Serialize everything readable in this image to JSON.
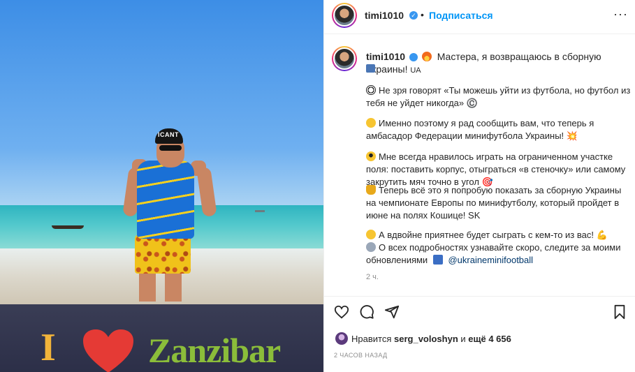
{
  "post_image": {
    "cap_text": "ICANT",
    "banner_i": "I",
    "banner_word": "Zanzibar"
  },
  "header": {
    "username": "timi1010",
    "separator": "•",
    "follow_label": "Подписаться",
    "more_label": "···"
  },
  "caption": {
    "username": "timi1010",
    "headline": "Мастера, я возвращаюсь в сборную Украины!",
    "flag": "UA",
    "lines": [
      "Не зря говорят «Ты можешь уйти из футбола, но футбол из тебя не уйдет никогда» ©️",
      "Именно поэтому я рад сообщить вам, что теперь я амбасадор Федерации минифутбола Украины! 💥",
      "Мне всегда нравилось играть на ограниченном участке поля: поставить корпус, отыграться «в стеночку» или самому закрутить мяч точно в угол 🎯",
      "Теперь всё это я попробую показать за сборную Украины на чемпионате Европы по минифутболу, который пройдет в июне на полях Кошице! SK",
      "А вдвойне приятнее будет сыграть с кем-то из вас! 💪",
      "О всех подробностях узнавайте скоро, следите за моими обновлениями"
    ],
    "mention": "@ukraineminifootball",
    "time": "2 ч."
  },
  "likes": {
    "prefix": "Нравится",
    "user": "serg_voloshyn",
    "middle": "и",
    "others": "ещё 4 656"
  },
  "posted_ago": "2 ЧАСОВ НАЗАД",
  "colors": {
    "accent": "#0095f6",
    "verified": "#3897f0",
    "text": "#262626",
    "muted": "#8e8e8e"
  }
}
